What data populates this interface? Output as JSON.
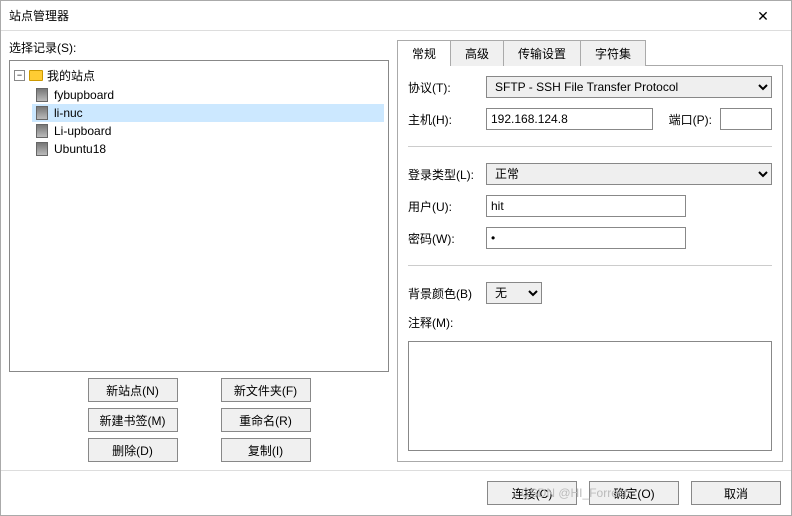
{
  "title": "站点管理器",
  "left": {
    "label": "选择记录(S):",
    "root": "我的站点",
    "sites": [
      "fybupboard",
      "li-nuc",
      "Li-upboard",
      "Ubuntu18"
    ],
    "selected_index": 1,
    "buttons": {
      "new_site": "新站点(N)",
      "new_folder": "新文件夹(F)",
      "new_bookmark": "新建书签(M)",
      "rename": "重命名(R)",
      "delete": "删除(D)",
      "copy": "复制(I)"
    }
  },
  "tabs": [
    "常规",
    "高级",
    "传输设置",
    "字符集"
  ],
  "general": {
    "protocol_label": "协议(T):",
    "protocol_value": "SFTP - SSH File Transfer Protocol",
    "host_label": "主机(H):",
    "host_value": "192.168.124.8",
    "port_label": "端口(P):",
    "port_value": "",
    "login_type_label": "登录类型(L):",
    "login_type_value": "正常",
    "user_label": "用户(U):",
    "user_value": "hit",
    "password_label": "密码(W):",
    "password_value": "•",
    "bg_label": "背景颜色(B)",
    "bg_value": "无",
    "notes_label": "注释(M):",
    "notes_value": ""
  },
  "footer": {
    "connect": "连接(C)",
    "ok": "确定(O)",
    "cancel": "取消"
  },
  "watermark": "CSDN @HI_Forrest"
}
